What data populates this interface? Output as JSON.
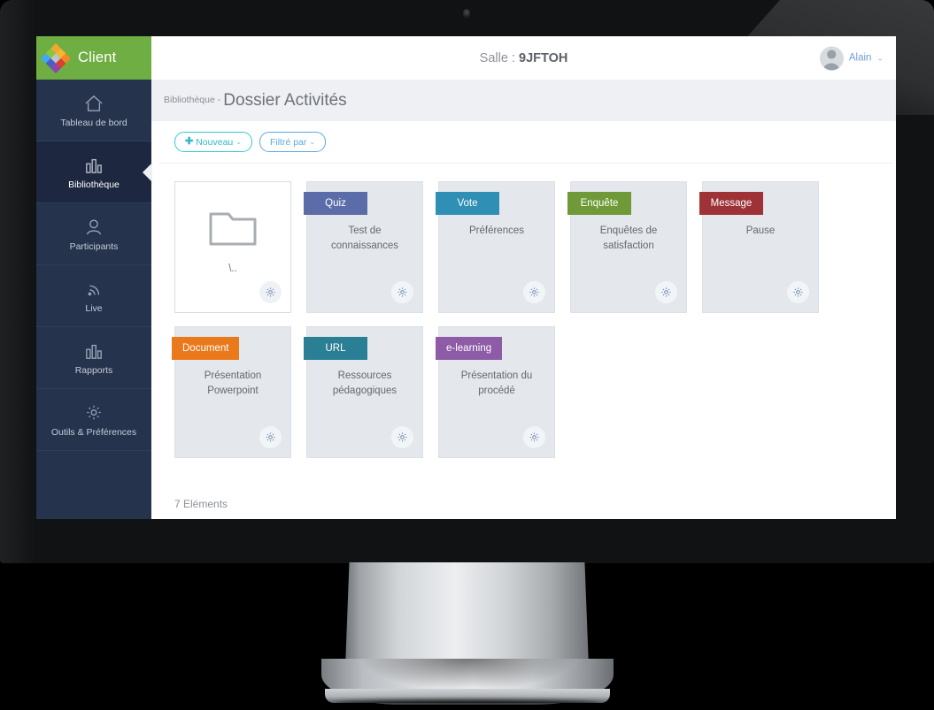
{
  "brand": {
    "name": "Client",
    "bar_color": "#6fae42",
    "logo_colors": [
      "#f0a830",
      "#f5b731",
      "#f08a24",
      "#8cc63f",
      "#bfc4c8",
      "#e03c31",
      "#3fa9f5",
      "#4a5fc1",
      "#8e44ad"
    ]
  },
  "topbar": {
    "room_label": "Salle :",
    "room_code": "9JFTOH",
    "user_name": "Alain",
    "caret": "⌄"
  },
  "sidebar": {
    "items": [
      {
        "label": "Tableau de bord",
        "icon": "home-icon",
        "active": false
      },
      {
        "label": "Bibliothèque",
        "icon": "chart-bars-icon",
        "active": true
      },
      {
        "label": "Participants",
        "icon": "user-icon",
        "active": false
      },
      {
        "label": "Live",
        "icon": "broadcast-icon",
        "active": false
      },
      {
        "label": "Rapports",
        "icon": "chart-bars-icon",
        "active": false
      },
      {
        "label": "Outils & Préférences",
        "icon": "gear-icon",
        "active": false
      }
    ]
  },
  "page": {
    "breadcrumb": "Bibliothèque",
    "breadcrumb_separator": "-",
    "title": "Dossier Activités",
    "footer_count": "7 Eléments"
  },
  "toolbar": {
    "new_label": "Nouveau",
    "new_plus": "✚",
    "filter_label": "Filtré par",
    "chevron": "⌄"
  },
  "cards": [
    {
      "type": "folder",
      "name": "\\..",
      "badge": null,
      "badge_color": null,
      "title": null
    },
    {
      "type": "item",
      "badge": "Quiz",
      "badge_color": "#5b6ca8",
      "title": "Test de connaissances"
    },
    {
      "type": "item",
      "badge": "Vote",
      "badge_color": "#2f8fb5",
      "title": "Préférences"
    },
    {
      "type": "item",
      "badge": "Enquête",
      "badge_color": "#6f9a37",
      "title": "Enquêtes de satisfaction"
    },
    {
      "type": "item",
      "badge": "Message",
      "badge_color": "#9e3236",
      "title": "Pause"
    },
    {
      "type": "item",
      "badge": "Document",
      "badge_color": "#e9791b",
      "title": "Présentation Powerpoint"
    },
    {
      "type": "item",
      "badge": "URL",
      "badge_color": "#2b7f95",
      "title": "Ressources pédagogiques"
    },
    {
      "type": "item",
      "badge": "e-learning",
      "badge_color": "#8e5ba6",
      "title": "Présentation du procédé"
    }
  ]
}
